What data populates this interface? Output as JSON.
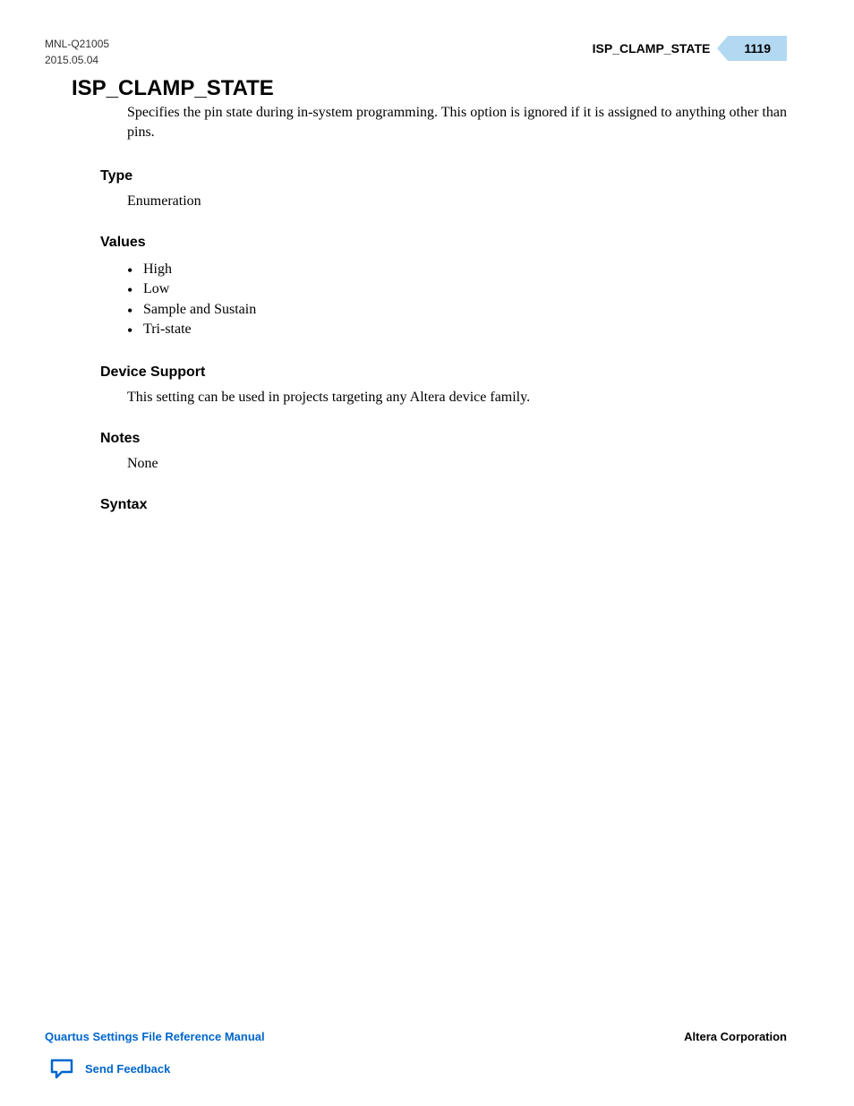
{
  "header": {
    "doc_id": "MNL-Q21005",
    "date": "2015.05.04",
    "section_title": "ISP_CLAMP_STATE",
    "page_number": "1119"
  },
  "main": {
    "heading": "ISP_CLAMP_STATE",
    "intro": "Specifies the pin state during in-system programming. This option is ignored if it is assigned to anything other than pins.",
    "sections": {
      "type": {
        "heading": "Type",
        "body": "Enumeration"
      },
      "values": {
        "heading": "Values",
        "items": [
          "High",
          "Low",
          "Sample and Sustain",
          "Tri-state"
        ]
      },
      "device_support": {
        "heading": "Device Support",
        "body": "This setting can be used in projects targeting any Altera device family."
      },
      "notes": {
        "heading": "Notes",
        "body": "None"
      },
      "syntax": {
        "heading": "Syntax"
      }
    }
  },
  "footer": {
    "manual_title": "Quartus Settings File Reference Manual",
    "company": "Altera Corporation",
    "feedback_label": "Send Feedback"
  }
}
